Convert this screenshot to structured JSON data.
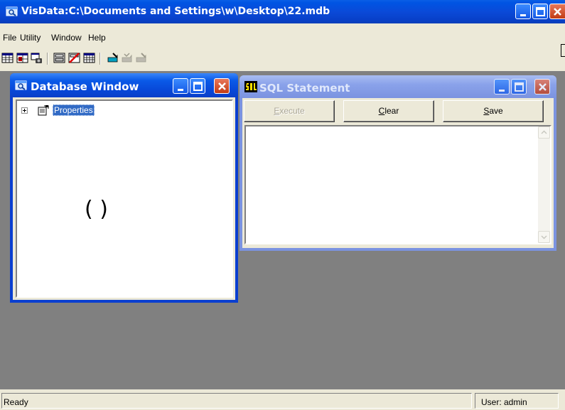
{
  "app": {
    "title": "VisData:C:\\Documents and Settings\\w\\Desktop\\22.mdb"
  },
  "menu": [
    "File",
    "Utility",
    "Window",
    "Help"
  ],
  "toolbar_icons": [
    "table-type-icon",
    "dynaset-type-icon",
    "snapshot-type-icon",
    "data-control-icon",
    "no-data-control-icon",
    "grid-icon",
    "begin-transaction-icon",
    "commit-icon",
    "rollback-icon"
  ],
  "database_window": {
    "title": "Database Window",
    "tree": [
      {
        "label": "Properties",
        "expanded": false
      }
    ],
    "overlay_text": "( )"
  },
  "sql_window": {
    "title": "SQL Statement",
    "buttons": {
      "execute": "Execute",
      "clear": "Clear",
      "save": "Save"
    },
    "text": ""
  },
  "status": {
    "left": "Ready",
    "right": "User: admin"
  },
  "colors": {
    "title_active": "#0a4ad8",
    "title_inactive": "#7b93e0",
    "mdi_bg": "#808080",
    "face": "#ece9d8",
    "selection": "#316ac5"
  }
}
